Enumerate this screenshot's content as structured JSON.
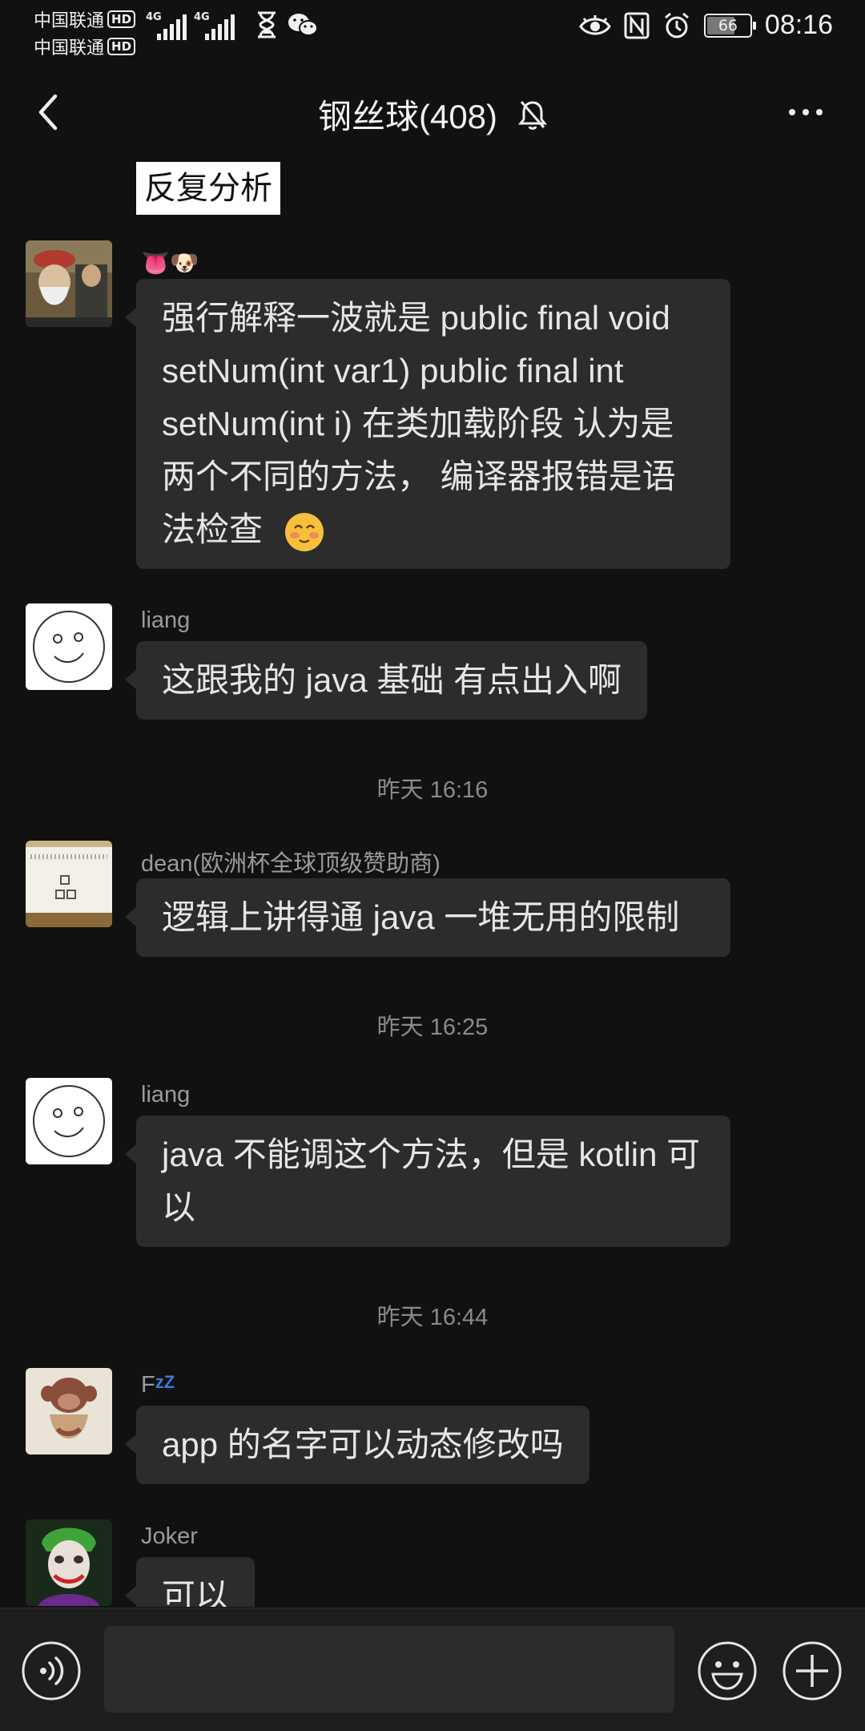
{
  "status_bar": {
    "carrier_1": "中国联通",
    "carrier_2": "中国联通",
    "hd_badge": "HD",
    "network_1": "4G",
    "network_2": "4G",
    "battery_level": "66",
    "battery_fraction": 0.66,
    "time": "08:16"
  },
  "header": {
    "title": "钢丝球(408)"
  },
  "messages": {
    "quote_text": "反复分析",
    "m1": {
      "sender_emojis": "👅🐶",
      "text": "强行解释一波就是   public final void setNum(int var1)  public final int setNum(int i)  在类加载阶段 认为是两个不同的方法，  编译器报错是语法检查"
    },
    "m2": {
      "sender": "liang",
      "text": "这跟我的 java 基础 有点出入啊"
    },
    "t1": "昨天 16:16",
    "m3": {
      "sender": "dean(欧洲杯全球顶级赞助商)",
      "text": "逻辑上讲得通 java 一堆无用的限制"
    },
    "t2": "昨天 16:25",
    "m4": {
      "sender": "liang",
      "text": "java 不能调这个方法，但是 kotlin 可以"
    },
    "t3": "昨天 16:44",
    "m5": {
      "sender": "F",
      "sender_suffix": "zZ",
      "text": "app 的名字可以动态修改吗"
    },
    "m6": {
      "sender": "Joker",
      "text": "可以"
    }
  },
  "input_bar": {
    "placeholder": "",
    "icons": [
      "voice-icon",
      "emoji-icon",
      "plus-icon"
    ]
  },
  "colors": {
    "background": "#111111",
    "bubble": "#2c2c2c",
    "input_bar": "#1e1e1e"
  }
}
